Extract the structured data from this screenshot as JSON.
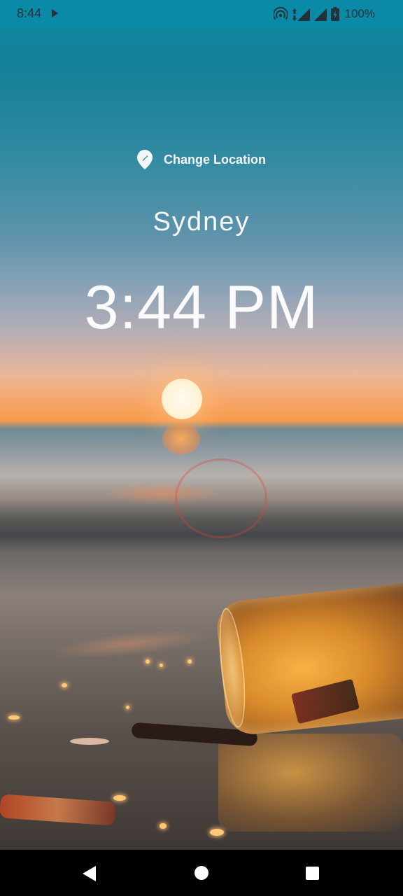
{
  "status_bar": {
    "time": "8:44",
    "battery_percent": "100%",
    "icons": [
      "play-icon",
      "hotspot-icon",
      "data-4g-icon",
      "signal-icon",
      "signal-icon",
      "battery-icon"
    ]
  },
  "location": {
    "change_label": "Change Location",
    "icon": "location-pin-icon"
  },
  "city": "Sydney",
  "time": "3:44 PM",
  "nav_bar": {
    "icons": [
      "back-icon",
      "home-icon",
      "recents-icon"
    ]
  },
  "colors": {
    "status_bar_bg": "#0a8aa6",
    "text": "#ffffff",
    "nav_bar_bg": "#000000"
  }
}
